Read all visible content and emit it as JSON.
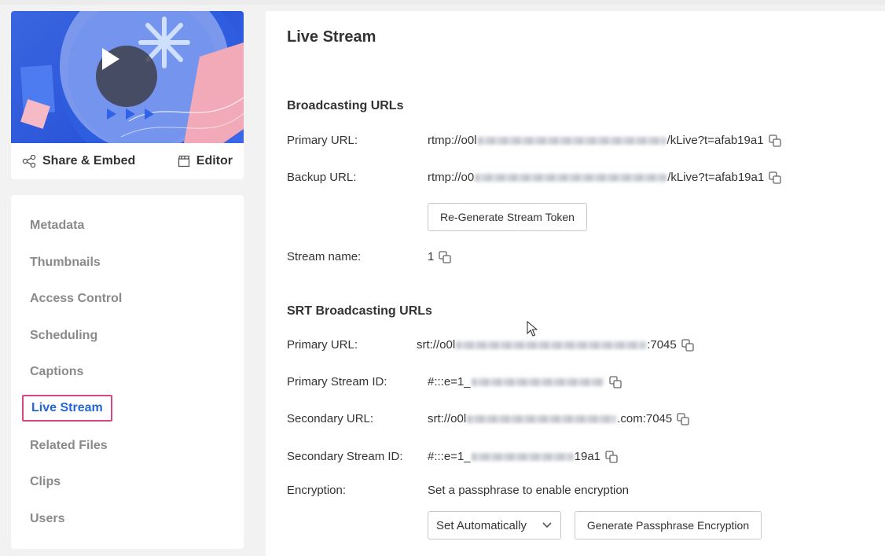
{
  "player": {
    "share_label": "Share & Embed",
    "editor_label": "Editor"
  },
  "nav": {
    "items": [
      {
        "label": "Metadata"
      },
      {
        "label": "Thumbnails"
      },
      {
        "label": "Access Control"
      },
      {
        "label": "Scheduling"
      },
      {
        "label": "Captions"
      },
      {
        "label": "Live Stream"
      },
      {
        "label": "Related Files"
      },
      {
        "label": "Clips"
      },
      {
        "label": "Users"
      }
    ],
    "active": "Live Stream"
  },
  "main": {
    "title": "Live Stream",
    "broadcasting": {
      "heading": "Broadcasting URLs",
      "primary_label": "Primary URL:",
      "primary_prefix": "rtmp://o0l",
      "primary_suffix": "/kLive?t=afab19a1",
      "backup_label": "Backup URL:",
      "backup_prefix": "rtmp://o0",
      "backup_suffix": "/kLive?t=afab19a1",
      "regenerate_button": "Re-Generate Stream Token",
      "stream_name_label": "Stream name:",
      "stream_name_value": "1"
    },
    "srt": {
      "heading": "SRT Broadcasting URLs",
      "primary_url_label": "Primary URL:",
      "primary_url_prefix": "srt://o0l",
      "primary_url_suffix": ":7045",
      "primary_stream_id_label": "Primary Stream ID:",
      "primary_stream_id_prefix": "#:::e=1_",
      "secondary_url_label": "Secondary URL:",
      "secondary_url_prefix": "srt://o0l",
      "secondary_url_suffix": ".com:7045",
      "secondary_stream_id_label": "Secondary Stream ID:",
      "secondary_stream_id_prefix": "#:::e=1_",
      "secondary_stream_id_suffix": "19a1",
      "encryption_label": "Encryption:",
      "encryption_text": "Set a passphrase to enable encryption",
      "encryption_select_value": "Set Automatically",
      "generate_button": "Generate Passphrase Encryption"
    }
  },
  "colors": {
    "active_nav": "#2466d6",
    "active_border": "#d9467f",
    "thumb_blue": "#2a55d9"
  },
  "icons": [
    "play-icon",
    "share-icon",
    "editor-icon",
    "copy-icon",
    "chevron-down-icon",
    "mouse-pointer-icon"
  ]
}
